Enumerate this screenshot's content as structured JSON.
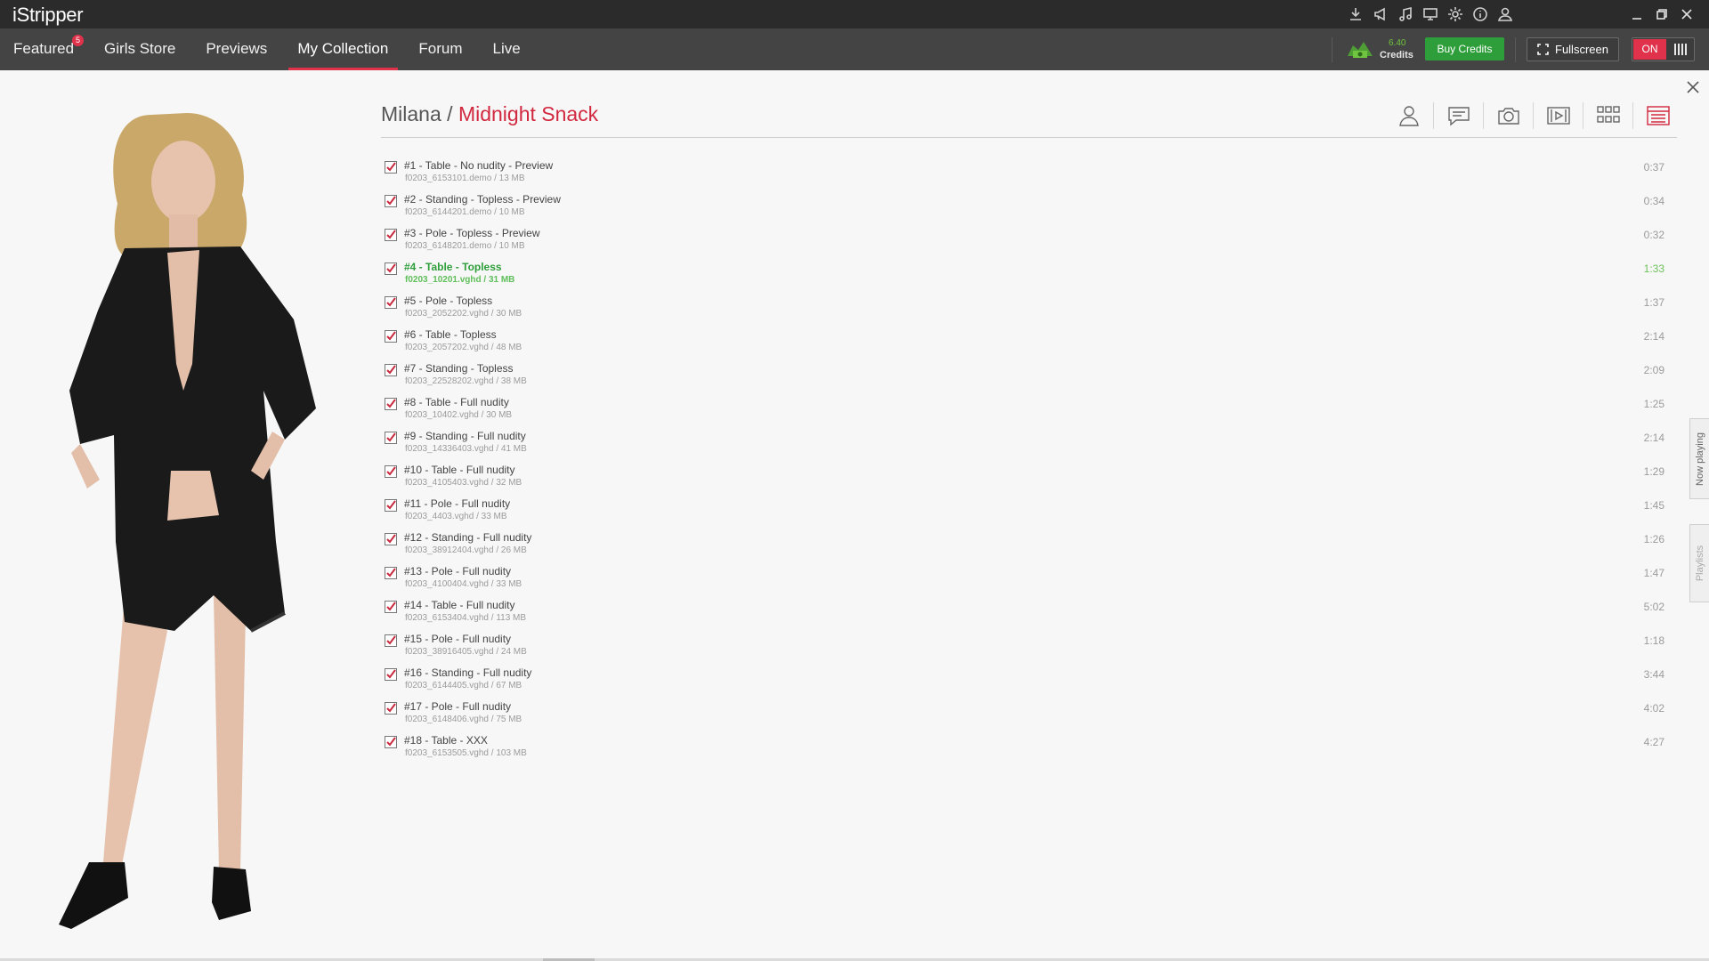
{
  "app": {
    "logo": "iStripper"
  },
  "titlebar": {
    "icons": [
      "download-icon",
      "announcement-icon",
      "music-icon",
      "display-icon",
      "settings-icon",
      "info-icon",
      "user-icon"
    ],
    "window_controls": [
      "minimize-icon",
      "restore-icon",
      "close-icon"
    ]
  },
  "nav": {
    "tabs": [
      {
        "label": "Featured",
        "badge": "5"
      },
      {
        "label": "Girls Store"
      },
      {
        "label": "Previews"
      },
      {
        "label": "My Collection",
        "active": true
      },
      {
        "label": "Forum"
      },
      {
        "label": "Live"
      }
    ],
    "credits_value": "6.40",
    "credits_label": "Credits",
    "buy_credits": "Buy Credits",
    "fullscreen": "Fullscreen",
    "toggle": "ON"
  },
  "scene": {
    "model": "Milana",
    "separator": " / ",
    "title": "Midnight Snack",
    "view_icons": [
      "profile-icon",
      "comments-icon",
      "camera-icon",
      "video-icon",
      "grid-icon",
      "cards-icon"
    ]
  },
  "clips": [
    {
      "title": "#1 - Table - No nudity - Preview",
      "file": "f0203_6153101.demo / 13 MB",
      "duration": "0:37"
    },
    {
      "title": "#2 - Standing - Topless - Preview",
      "file": "f0203_6144201.demo / 10 MB",
      "duration": "0:34"
    },
    {
      "title": "#3 - Pole - Topless - Preview",
      "file": "f0203_6148201.demo / 10 MB",
      "duration": "0:32"
    },
    {
      "title": "#4 - Table - Topless",
      "file": "f0203_10201.vghd / 31 MB",
      "duration": "1:33",
      "playing": true
    },
    {
      "title": "#5 - Pole - Topless",
      "file": "f0203_2052202.vghd / 30 MB",
      "duration": "1:37"
    },
    {
      "title": "#6 - Table - Topless",
      "file": "f0203_2057202.vghd / 48 MB",
      "duration": "2:14"
    },
    {
      "title": "#7 - Standing - Topless",
      "file": "f0203_22528202.vghd / 38 MB",
      "duration": "2:09"
    },
    {
      "title": "#8 - Table - Full nudity",
      "file": "f0203_10402.vghd / 30 MB",
      "duration": "1:25"
    },
    {
      "title": "#9 - Standing - Full nudity",
      "file": "f0203_14336403.vghd / 41 MB",
      "duration": "2:14"
    },
    {
      "title": "#10 - Table - Full nudity",
      "file": "f0203_4105403.vghd / 32 MB",
      "duration": "1:29"
    },
    {
      "title": "#11 - Pole - Full nudity",
      "file": "f0203_4403.vghd / 33 MB",
      "duration": "1:45"
    },
    {
      "title": "#12 - Standing - Full nudity",
      "file": "f0203_38912404.vghd / 26 MB",
      "duration": "1:26"
    },
    {
      "title": "#13 - Pole - Full nudity",
      "file": "f0203_4100404.vghd / 33 MB",
      "duration": "1:47"
    },
    {
      "title": "#14 - Table - Full nudity",
      "file": "f0203_6153404.vghd / 113 MB",
      "duration": "5:02"
    },
    {
      "title": "#15 - Pole - Full nudity",
      "file": "f0203_38916405.vghd / 24 MB",
      "duration": "1:18"
    },
    {
      "title": "#16 - Standing - Full nudity",
      "file": "f0203_6144405.vghd / 67 MB",
      "duration": "3:44"
    },
    {
      "title": "#17 - Pole - Full nudity",
      "file": "f0203_6148406.vghd / 75 MB",
      "duration": "4:02"
    },
    {
      "title": "#18 - Table - XXX",
      "file": "f0203_6153505.vghd / 103 MB",
      "duration": "4:27"
    }
  ],
  "side_tabs": {
    "now_playing": "Now playing",
    "playlists": "Playlists"
  },
  "colors": {
    "accent": "#e0334b",
    "green": "#2e9e3a",
    "title_red": "#d2283f"
  }
}
